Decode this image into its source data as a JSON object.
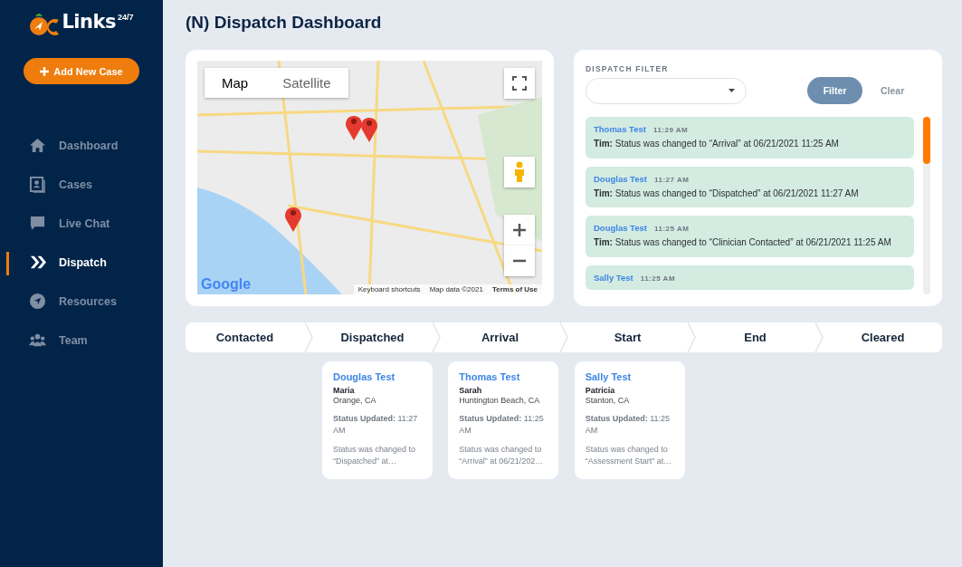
{
  "sidebar": {
    "logo": {
      "text": "Links",
      "superscript": "24/7"
    },
    "add_button": "Add New Case",
    "items": [
      {
        "label": "Dashboard",
        "kind": "home",
        "selected": false
      },
      {
        "label": "Cases",
        "kind": "contact",
        "selected": false
      },
      {
        "label": "Live Chat",
        "kind": "chat",
        "selected": false
      },
      {
        "label": "Dispatch",
        "kind": "chevrons",
        "selected": true
      },
      {
        "label": "Resources",
        "kind": "compass",
        "selected": false
      },
      {
        "label": "Team",
        "kind": "team",
        "selected": false
      }
    ]
  },
  "page_title": "(N) Dispatch Dashboard",
  "map": {
    "tabs": [
      {
        "label": "Map",
        "selected": true
      },
      {
        "label": "Satellite",
        "selected": false
      }
    ],
    "attribution": "Google",
    "footer": [
      "Keyboard shortcuts",
      "Map data ©2021",
      "Terms of Use"
    ]
  },
  "filter": {
    "label": "DISPATCH FILTER",
    "filter_button": "Filter",
    "clear_button": "Clear",
    "log": [
      {
        "name": "Thomas Test",
        "time": "11:29 AM",
        "author": "Tim:",
        "message": "Status was changed to “Arrival” at 06/21/2021 11:25 AM"
      },
      {
        "name": "Douglas Test",
        "time": "11:27 AM",
        "author": "Tim:",
        "message": "Status was changed to “Dispatched” at 06/21/2021 11:27 AM"
      },
      {
        "name": "Douglas Test",
        "time": "11:25 AM",
        "author": "Tim:",
        "message": "Status was changed to “Clinician Contacted” at 06/21/2021 11:25 AM"
      },
      {
        "name": "Sally Test",
        "time": "11:25 AM"
      }
    ]
  },
  "stages": [
    {
      "label": "Contacted"
    },
    {
      "label": "Dispatched",
      "cases": [
        {
          "name": "Douglas Test",
          "person": "Maria",
          "location": "Orange, CA",
          "updated_label": "Status Updated:",
          "updated": "11:27 AM",
          "note": "Status was changed to “Dispatched” at…"
        }
      ]
    },
    {
      "label": "Arrival",
      "cases": [
        {
          "name": "Thomas Test",
          "person": "Sarah",
          "location": "Huntington Beach, CA",
          "updated_label": "Status Updated:",
          "updated": "11:25 AM",
          "note": "Status was changed to “Arrival” at 06/21/202…"
        }
      ]
    },
    {
      "label": "Start",
      "cases": [
        {
          "name": "Sally Test",
          "person": "Patricia",
          "location": "Stanton, CA",
          "updated_label": "Status Updated:",
          "updated": "11:25 AM",
          "note": "Status was changed to “Assessment Start” at…"
        }
      ]
    },
    {
      "label": "End"
    },
    {
      "label": "Cleared"
    }
  ]
}
